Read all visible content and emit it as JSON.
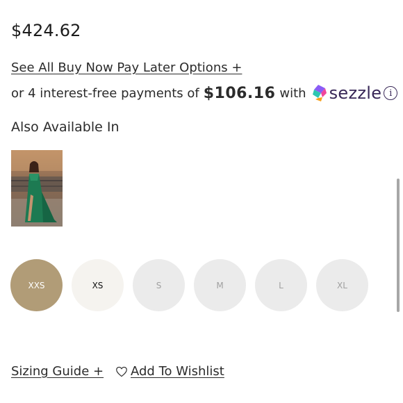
{
  "product": {
    "price": "$424.62"
  },
  "payment": {
    "bnpl_link": "See All Buy Now Pay Later Options +",
    "installment_prefix": "or 4 interest-free payments of",
    "installment_amount": "$106.16",
    "installment_with": "with",
    "provider_name": "sezzle",
    "info_glyph": "i",
    "provider_color": "#382757"
  },
  "variants": {
    "label": "Also Available In",
    "items": [
      {
        "color_name": "emerald green",
        "swatch_hex": "#1f6b4f"
      }
    ]
  },
  "sizes": {
    "options": [
      {
        "label": "XXS",
        "state": "selected"
      },
      {
        "label": "XS",
        "state": "available"
      },
      {
        "label": "S",
        "state": "unavailable"
      },
      {
        "label": "M",
        "state": "unavailable"
      },
      {
        "label": "L",
        "state": "unavailable"
      },
      {
        "label": "XL",
        "state": "unavailable"
      }
    ],
    "selected_color": "#b19c77"
  },
  "footer": {
    "sizing_guide": "Sizing Guide +",
    "wishlist": "Add To Wishlist"
  },
  "icons": {
    "wishlist": "heart-outline-icon",
    "info": "info-circle-icon",
    "sezzle_logo": "sezzle-logo-icon"
  }
}
